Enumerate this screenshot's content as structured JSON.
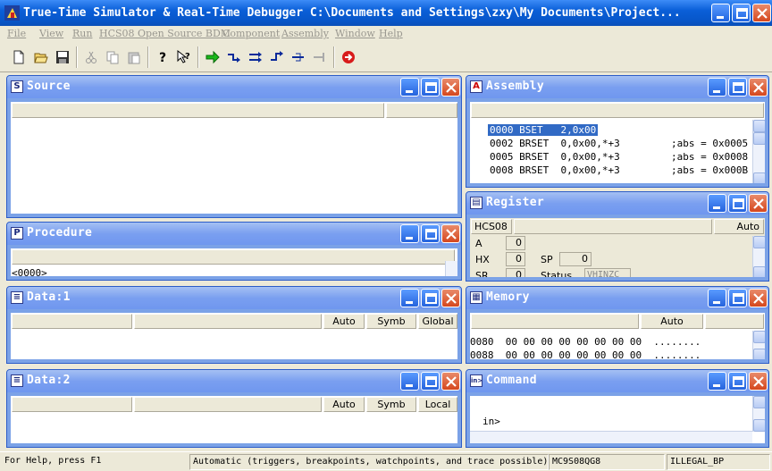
{
  "app": {
    "title": "True-Time Simulator & Real-Time Debugger   C:\\Documents and Settings\\zxy\\My Documents\\Project..."
  },
  "menu": [
    "File",
    "View",
    "Run",
    "HCS08 Open Source BDM",
    "Component",
    "Assembly",
    "Window",
    "Help"
  ],
  "toolbar": {
    "icons": [
      "new-file-icon",
      "open-folder-icon",
      "save-icon",
      "cut-icon",
      "copy-icon",
      "paste-icon",
      "help-icon",
      "context-help-icon",
      "start-continue-icon",
      "single-step-icon",
      "step-over-icon",
      "step-out-icon",
      "assembly-step-icon",
      "halt-icon",
      "reset-icon"
    ]
  },
  "windows": {
    "source": {
      "title": "Source",
      "icon_letter": "S"
    },
    "procedure": {
      "title": "Procedure",
      "icon_letter": "P",
      "entry": "<0000>"
    },
    "data1": {
      "title": "Data:1",
      "headers": [
        "Auto",
        "Symb",
        "Global"
      ]
    },
    "data2": {
      "title": "Data:2",
      "headers": [
        "Auto",
        "Symb",
        "Local"
      ]
    },
    "assembly": {
      "title": "Assembly",
      "icon_letter": "A",
      "lines": [
        {
          "addr": "0000",
          "mnemonic": "BSET",
          "operands": "2,0x00",
          "comment": ""
        },
        {
          "addr": "0002",
          "mnemonic": "BRSET",
          "operands": "0,0x00,*+3",
          "comment": ";abs = 0x0005"
        },
        {
          "addr": "0005",
          "mnemonic": "BRSET",
          "operands": "0,0x00,*+3",
          "comment": ";abs = 0x0008"
        },
        {
          "addr": "0008",
          "mnemonic": "BRSET",
          "operands": "0,0x00,*+3",
          "comment": ";abs = 0x000B"
        }
      ]
    },
    "register": {
      "title": "Register",
      "cpu": "HCS08",
      "mode": "Auto",
      "A_label": "A",
      "A_value": "0",
      "HX_label": "HX",
      "HX_value": "0",
      "SP_label": "SP",
      "SP_value": "0",
      "SR_label": "SR",
      "SR_value": "0",
      "status_label": "Status",
      "status_value": "VHINZC"
    },
    "memory": {
      "title": "Memory",
      "mode": "Auto",
      "rows": [
        {
          "addr": "0080",
          "bytes": "00 00 00 00 00 00 00 00",
          "ascii": "........"
        },
        {
          "addr": "0088",
          "bytes": "00 00 00 00 00 00 00 00",
          "ascii": "........"
        }
      ]
    },
    "command": {
      "title": "Command",
      "prompt": "in>"
    }
  },
  "status": {
    "help": "For Help, press F1",
    "mode": "Automatic (triggers, breakpoints, watchpoints, and trace possible)",
    "device": "MC9S08QG8",
    "state": "ILLEGAL_BP"
  },
  "colors": {
    "title_bar": "#0a5fd8",
    "child_caption": "#7a9ff0",
    "selection": "#316ac5",
    "close_button": "#d5471e"
  }
}
